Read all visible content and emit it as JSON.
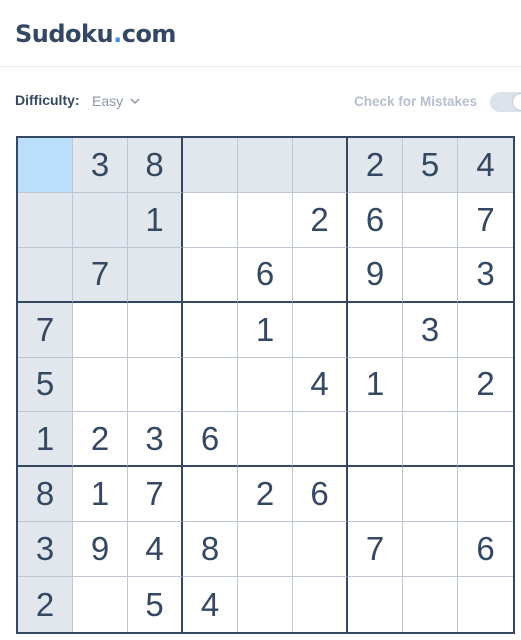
{
  "app": {
    "logo_text": "Sudoku",
    "logo_dot": ".",
    "logo_tld": "com"
  },
  "toolbar": {
    "difficulty_label": "Difficulty:",
    "difficulty_value": "Easy",
    "mistakes_label": "Check for Mistakes",
    "mistakes_enabled": false
  },
  "colors": {
    "text": "#344861",
    "accent": "#4a90e2",
    "highlight": "#e2e7ed",
    "selected": "#bbdefb"
  },
  "board": {
    "selected": [
      0,
      0
    ],
    "cells": [
      [
        "",
        "3",
        "8",
        "",
        "",
        "",
        "2",
        "5",
        "4"
      ],
      [
        "",
        "",
        "1",
        "",
        "",
        "2",
        "6",
        "",
        "7"
      ],
      [
        "",
        "7",
        "",
        "",
        "6",
        "",
        "9",
        "",
        "3"
      ],
      [
        "7",
        "",
        "",
        "",
        "1",
        "",
        "",
        "3",
        ""
      ],
      [
        "5",
        "",
        "",
        "",
        "",
        "4",
        "1",
        "",
        "2"
      ],
      [
        "1",
        "2",
        "3",
        "6",
        "",
        "",
        "",
        "",
        ""
      ],
      [
        "8",
        "1",
        "7",
        "",
        "2",
        "6",
        "",
        "",
        ""
      ],
      [
        "3",
        "9",
        "4",
        "8",
        "",
        "",
        "7",
        "",
        "6"
      ],
      [
        "2",
        "",
        "5",
        "4",
        "",
        "",
        "",
        "",
        ""
      ]
    ]
  }
}
